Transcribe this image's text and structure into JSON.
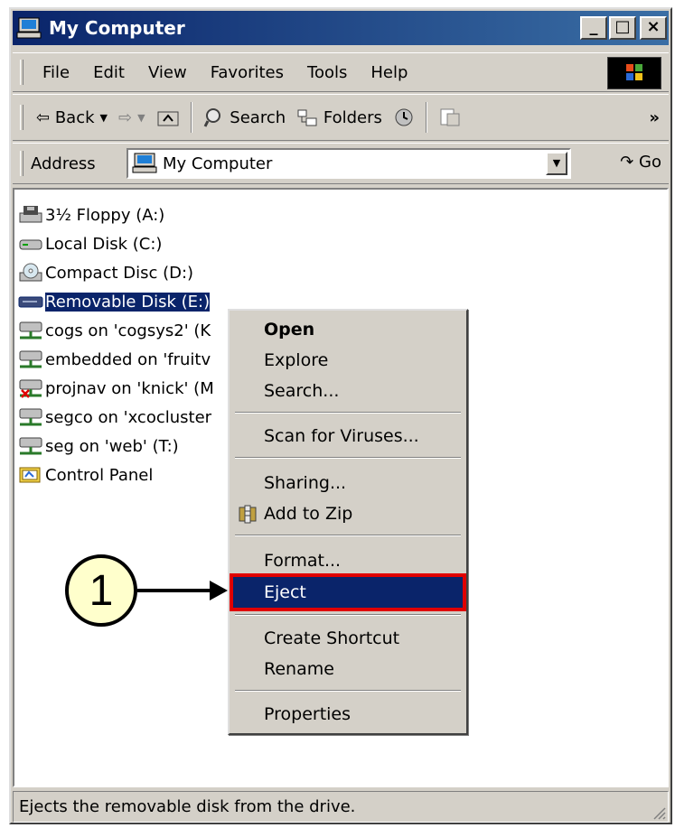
{
  "window": {
    "title": "My Computer",
    "minimize": "_",
    "maximize": "□",
    "close": "×"
  },
  "menubar": {
    "items": [
      "File",
      "Edit",
      "View",
      "Favorites",
      "Tools",
      "Help"
    ]
  },
  "toolbar": {
    "back": "Back",
    "search": "Search",
    "folders": "Folders",
    "overflow": "»"
  },
  "addressbar": {
    "label": "Address",
    "value": "My Computer",
    "go": "Go"
  },
  "items": [
    {
      "label": "3½ Floppy (A:)",
      "icon": "floppy-drive-icon"
    },
    {
      "label": "Local Disk (C:)",
      "icon": "hard-disk-icon"
    },
    {
      "label": "Compact Disc (D:)",
      "icon": "cd-drive-icon"
    },
    {
      "label": "Removable Disk (E:)",
      "icon": "removable-disk-icon",
      "selected": true
    },
    {
      "label": "cogs on 'cogsys2' (K",
      "icon": "network-drive-icon"
    },
    {
      "label": "embedded on 'fruitv",
      "icon": "network-drive-icon"
    },
    {
      "label": "projnav on 'knick' (M",
      "icon": "disconnected-network-drive-icon"
    },
    {
      "label": "segco on 'xcocluster",
      "icon": "network-drive-icon"
    },
    {
      "label": "seg on 'web' (T:)",
      "icon": "network-drive-icon"
    },
    {
      "label": "Control Panel",
      "icon": "control-panel-icon"
    }
  ],
  "context_menu": {
    "open": "Open",
    "explore": "Explore",
    "search": "Search...",
    "scan": "Scan for Viruses...",
    "sharing": "Sharing...",
    "add_to_zip": "Add to Zip",
    "format": "Format...",
    "eject": "Eject",
    "create_shortcut": "Create Shortcut",
    "rename": "Rename",
    "properties": "Properties"
  },
  "callout": {
    "number": "1"
  },
  "status": {
    "text": "Ejects the removable disk from the drive."
  },
  "colors": {
    "titlebar": "#0a246a",
    "selection": "#0a246a",
    "highlight_border": "#e00000",
    "callout_fill": "#ffffcc"
  }
}
